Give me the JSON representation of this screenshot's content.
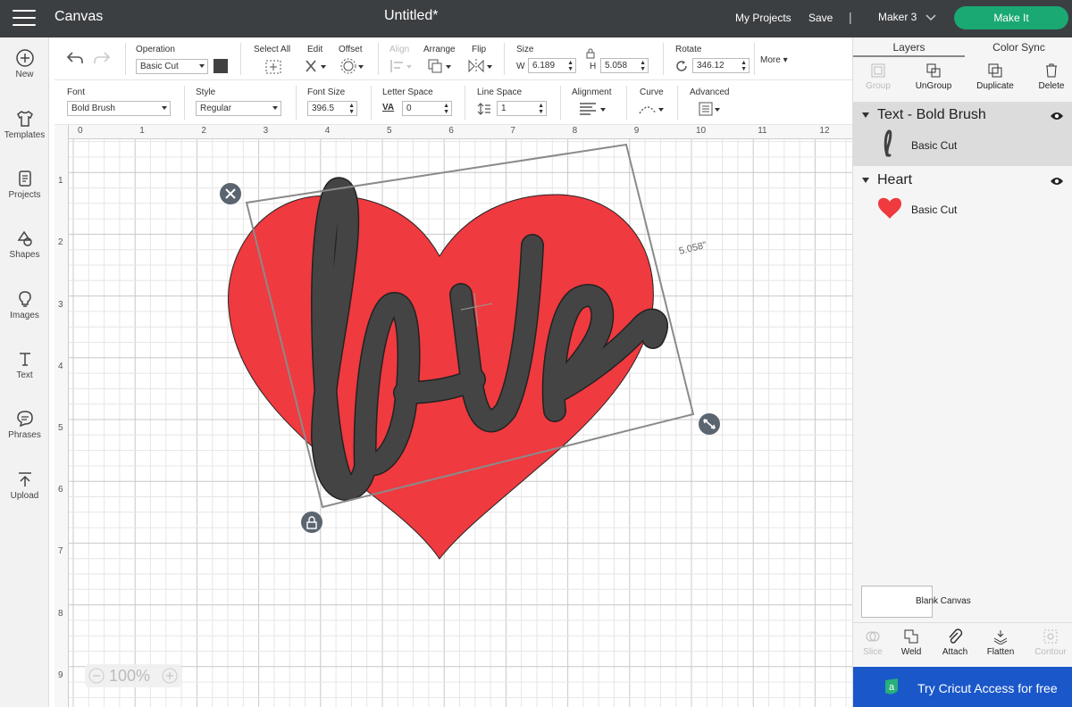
{
  "topbar": {
    "app_title": "Canvas",
    "doc_title": "Untitled*",
    "my_projects": "My Projects",
    "save": "Save",
    "separator": "|",
    "machine": "Maker 3",
    "make_it": "Make It"
  },
  "leftnav": {
    "new": "New",
    "templates": "Templates",
    "projects": "Projects",
    "shapes": "Shapes",
    "images": "Images",
    "text": "Text",
    "phrases": "Phrases",
    "upload": "Upload"
  },
  "toolbar": {
    "operation_label": "Operation",
    "operation_value": "Basic Cut",
    "operation_color": "#414141",
    "select_all": "Select All",
    "edit": "Edit",
    "offset": "Offset",
    "align": "Align",
    "arrange": "Arrange",
    "flip": "Flip",
    "size_label": "Size",
    "w_label": "W",
    "w_value": "6.189",
    "h_label": "H",
    "h_value": "5.058",
    "rotate_label": "Rotate",
    "rotate_value": "346.12",
    "more": "More"
  },
  "text_toolbar": {
    "font_label": "Font",
    "font_value": "Bold Brush",
    "style_label": "Style",
    "style_value": "Regular",
    "font_size_label": "Font Size",
    "font_size_value": "396.5",
    "letter_space_label": "Letter Space",
    "letter_space_icon": "VA",
    "letter_space_value": "0",
    "line_space_label": "Line Space",
    "line_space_value": "1",
    "alignment_label": "Alignment",
    "curve_label": "Curve",
    "advanced_label": "Advanced"
  },
  "canvas": {
    "ruler_top": [
      "0",
      "1",
      "2",
      "3",
      "4",
      "5",
      "6",
      "7",
      "8",
      "9",
      "10",
      "11",
      "12"
    ],
    "ruler_left": [
      "1",
      "2",
      "3",
      "4",
      "5",
      "6",
      "7",
      "8",
      "9"
    ],
    "dimension_label": "5.058\"",
    "text_object": "love",
    "heart_color": "#ef3a3f",
    "text_color": "#414141",
    "zoom": "100%"
  },
  "layers_panel": {
    "tabs": [
      "Layers",
      "Color Sync"
    ],
    "tools": [
      "Group",
      "UnGroup",
      "Duplicate",
      "Delete"
    ],
    "groups": [
      {
        "name": "Text - Bold Brush",
        "sub": "Basic Cut"
      },
      {
        "name": "Heart",
        "sub": "Basic Cut"
      }
    ],
    "blank_canvas": "Blank Canvas",
    "bottom_tools": [
      "Slice",
      "Weld",
      "Attach",
      "Flatten",
      "Contour"
    ],
    "access_banner": "Try Cricut Access for free"
  },
  "colors": {
    "topbar": "#3c3f42",
    "make_it": "#1aa873",
    "access_banner": "#1a57c9"
  }
}
